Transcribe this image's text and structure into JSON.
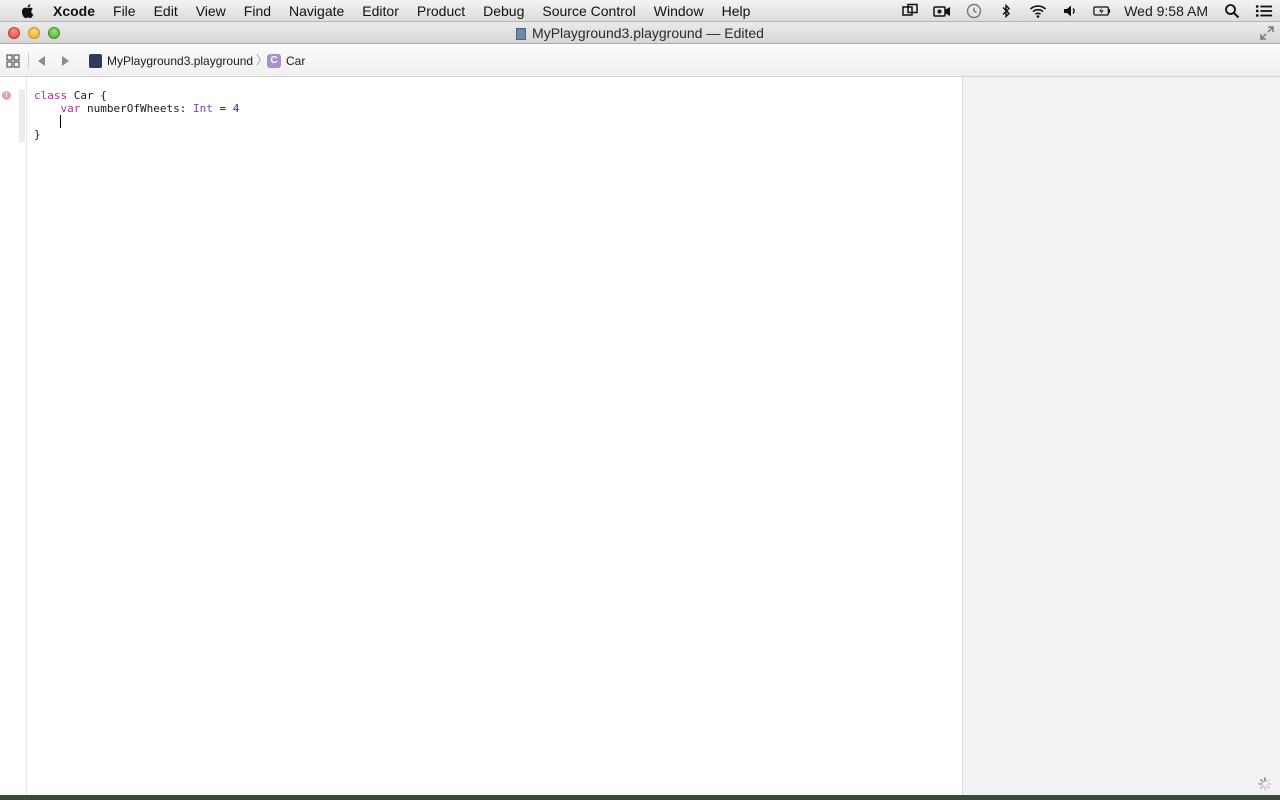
{
  "menubar": {
    "app_name": "Xcode",
    "items": [
      "File",
      "Edit",
      "View",
      "Find",
      "Navigate",
      "Editor",
      "Product",
      "Debug",
      "Source Control",
      "Window",
      "Help"
    ],
    "clock": "Wed 9:58 AM"
  },
  "window": {
    "title": "MyPlayground3.playground — Edited"
  },
  "jumpbar": {
    "file": "MyPlayground3.playground",
    "separator": "〉",
    "class_icon_letter": "C",
    "class_name": "Car"
  },
  "editor": {
    "error_marker": "!",
    "line1": {
      "kw": "class",
      "rest": " Car {"
    },
    "line2": {
      "indent": "    ",
      "kw": "var",
      "name": " numberOfWheets: ",
      "type": "Int",
      "op": " = ",
      "num": "4"
    },
    "line4": "}"
  },
  "colors": {
    "keyword": "#a5329f",
    "type": "#7d45b8",
    "number": "#1f2ad0",
    "results_bg": "#f3f2f5"
  }
}
